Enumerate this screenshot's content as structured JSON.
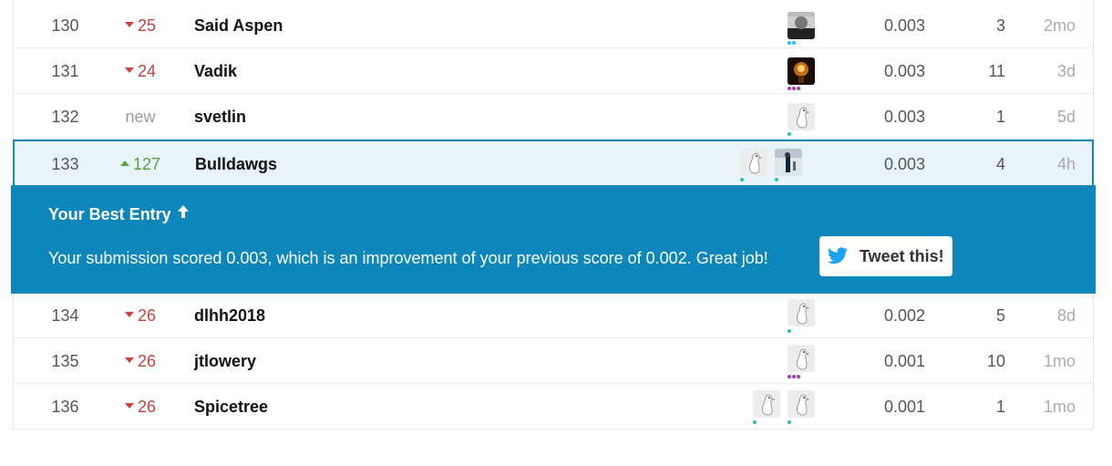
{
  "rows_before": [
    {
      "rank": "130",
      "change": "25",
      "dir": "down",
      "team": "Said Aspen",
      "score": "0.003",
      "entries": "3",
      "last": "2mo"
    },
    {
      "rank": "131",
      "change": "24",
      "dir": "down",
      "team": "Vadik",
      "score": "0.003",
      "entries": "11",
      "last": "3d"
    },
    {
      "rank": "132",
      "change": "new",
      "dir": "new",
      "team": "svetlin",
      "score": "0.003",
      "entries": "1",
      "last": "5d"
    }
  ],
  "highlight_row": {
    "rank": "133",
    "change": "127",
    "dir": "up",
    "team": "Bulldawgs",
    "score": "0.003",
    "entries": "4",
    "last": "4h"
  },
  "banner": {
    "title": "Your Best Entry",
    "message": "Your submission scored 0.003, which is an improvement of your previous score of 0.002. Great job!",
    "tweet_label": "Tweet this!"
  },
  "rows_after": [
    {
      "rank": "134",
      "change": "26",
      "dir": "down",
      "team": "dlhh2018",
      "score": "0.002",
      "entries": "5",
      "last": "8d"
    },
    {
      "rank": "135",
      "change": "26",
      "dir": "down",
      "team": "jtlowery",
      "score": "0.001",
      "entries": "10",
      "last": "1mo"
    },
    {
      "rank": "136",
      "change": "26",
      "dir": "down",
      "team": "Spicetree",
      "score": "0.001",
      "entries": "1",
      "last": "1mo"
    }
  ],
  "colors": {
    "accent": "#0d87bb",
    "up": "#5a9e3d",
    "down": "#c9423d",
    "twitter": "#1da1f2"
  }
}
